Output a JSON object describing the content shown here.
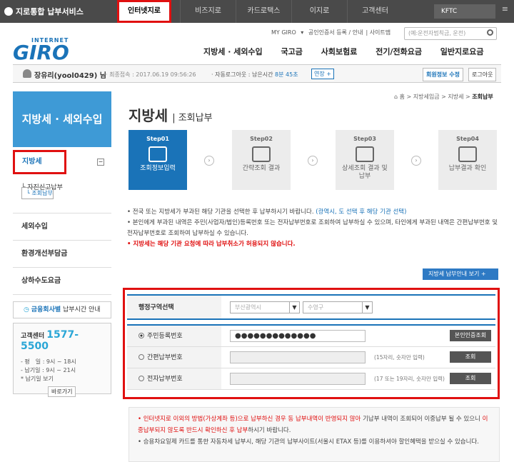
{
  "topbar": {
    "brand": "지로통합 납부서비스",
    "tabs": [
      "인터넷지로",
      "비즈지로",
      "카드로택스",
      "이지로",
      "고객센터"
    ],
    "kftc": "KFTC"
  },
  "utility": {
    "links": [
      "MY GIRO",
      "공인인증서 등록 / 안내",
      "사이트맵"
    ],
    "search_placeholder": "(예:운전자범칙금, 운전)"
  },
  "logo": {
    "internet": "INTERNET",
    "giro": "GIRO"
  },
  "gnb": [
    "지방세 · 세외수입",
    "국고금",
    "사회보험료",
    "전기/전화요금",
    "일반지로요금"
  ],
  "user": {
    "name": "장유리(yool0429) 님",
    "last_login": "· 최종접속 : 2017.06.19 09:56:26",
    "auto_logout_label": "· 자동로그아웃 : 남은시간",
    "remaining": "8분 45초",
    "extend": "연장",
    "edit_btn": "회원정보 수정",
    "logout_btn": "로그아웃"
  },
  "lnb": {
    "title": "지방세 · 세외수입",
    "active_item": "지방세",
    "sub": [
      "조회납부",
      "자진신고납부"
    ],
    "items": [
      "세외수입",
      "환경개선부담금",
      "상하수도요금"
    ]
  },
  "side": {
    "finance": "금융회사별",
    "finance_rest": "납부시간 안내",
    "center_label": "고객센터",
    "center_tel": "1577-5500",
    "lines": [
      "- 평　일 : 9시 ~ 18시",
      "- 납기일 : 9시 ~ 21시",
      "* 납기일 보기"
    ],
    "go": "바로가기"
  },
  "breadcrumb": {
    "home": "홈",
    "path1": "지방세입금",
    "path2": "지방세",
    "current": "조회납부"
  },
  "page": {
    "title": "지방세",
    "subtitle": "조회납부"
  },
  "steps": [
    {
      "n": "Step01",
      "label": "조회정보입력"
    },
    {
      "n": "Step02",
      "label": "간략조회 결과"
    },
    {
      "n": "Step03",
      "label": "상세조회 결과 및 납부"
    },
    {
      "n": "Step04",
      "label": "납부결과 확인"
    }
  ],
  "notes": {
    "n1": "• 전국 또는 지방세가 부과된 해당 기관을 선택한 후 납부하시기 바랍니다.",
    "n1b": "(광역시, 도 선택 후 해당 기관 선택)",
    "n2": "• 본인에게 부과된 내역은 주민(사업자/법인)등록번호 또는 전자납부번호로 조회하여 납부하실 수 있으며, 타인에게 부과된 내역은 간편납부번호 및 전자납부번호로 조회하여 납부하실 수 있습니다.",
    "n3": "• 지방세는 해당 기관 요청에 따라 납부취소가 허용되지 않습니다."
  },
  "guide_btn": "지방세 납부안내 보기 +",
  "form": {
    "region_label": "행정구역선택",
    "region_sel1": "부산광역시",
    "region_sel2": "수영구",
    "rows": [
      {
        "label": "주민등록번호",
        "value": "●●●●●●●●●●●●●",
        "hint": "",
        "btn": "본인인증조회"
      },
      {
        "label": "간편납부번호",
        "value": "",
        "hint": "(15자리, 숫자만 입력)",
        "btn": "조회"
      },
      {
        "label": "전자납부번호",
        "value": "",
        "hint": "(17 또는 19자리, 숫자만 입력)",
        "btn": "조회"
      }
    ]
  },
  "bottom": {
    "red1": "• 인터넷지로 이외의 방법(가상계좌 등)으로 납부하신 경우 동 납부내역이 반영되지 않아",
    "rest1": "기납부 내역이 조회되어 이중납부 될 수 있으니",
    "red2": "이중납부되지 않도록 반드시 확인하신 후 납부",
    "rest2": "하시기 바랍니다.",
    "line3": "• 승용차요일제 카드를 통한 자동차세 납부시, 해당 기관의 납부사이트(서울시 ETAX 등)를 이용하셔야 할인혜택을 받으실 수 있습니다."
  }
}
